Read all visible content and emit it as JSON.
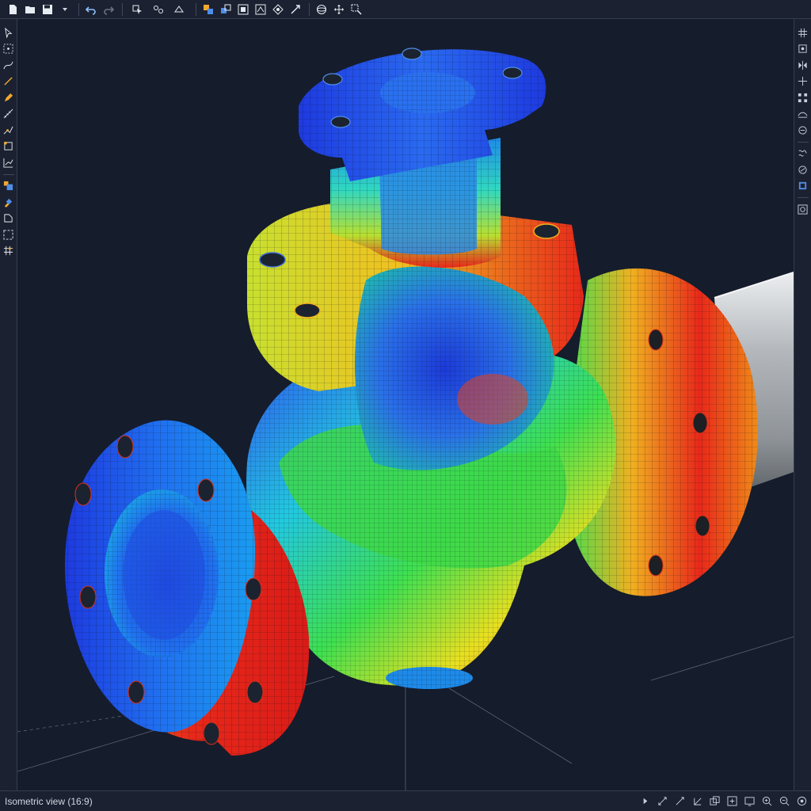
{
  "status": {
    "view_label": "Isometric view (16:9)"
  },
  "colors": {
    "background": "#151c2c",
    "chrome": "#1b2130",
    "stress_low": "#1b3fd8",
    "stress_mid": "#22d45a",
    "stress_high": "#e8201c",
    "pipe": "#b6b9bd"
  },
  "toolbar_icons": [
    "new-file-icon",
    "open-folder-icon",
    "save-icon",
    "save-dropdown-icon",
    "undo-icon",
    "redo-icon",
    "select-filter-icon",
    "group-select-icon",
    "transform-icon",
    "view-cube-icon",
    "view-front-icon",
    "view-top-icon",
    "view-side-icon",
    "fit-view-icon",
    "constraint-icon",
    "orbit-icon",
    "pan-icon",
    "zoom-window-icon"
  ],
  "left_tool_icons": [
    "select-arrow-icon",
    "node-select-icon",
    "curve-icon",
    "line-icon",
    "pen-icon",
    "ruler-icon",
    "spline-icon",
    "box-icon",
    "graph-icon",
    "layers-icon",
    "paint-icon",
    "document-icon",
    "region-icon",
    "mesh-icon"
  ],
  "right_tool_icons": [
    "grid-icon",
    "snap-icon",
    "mirror-icon",
    "move-icon",
    "array-icon",
    "surface-icon",
    "link-icon",
    "material-icon",
    "library-icon",
    "camera-icon",
    "settings-icon"
  ],
  "status_icons": [
    "cursor-icon",
    "measure-icon",
    "angle-icon",
    "ortho-icon",
    "copy-icon",
    "frame-icon",
    "display-icon",
    "zoom-in-icon",
    "zoom-out-icon",
    "render-icon"
  ]
}
